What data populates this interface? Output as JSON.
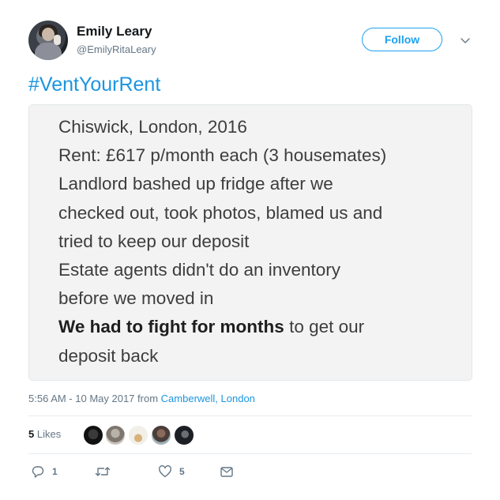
{
  "user": {
    "name": "Emily Leary",
    "handle": "@EmilyRitaLeary",
    "follow_label": "Follow"
  },
  "tweet": {
    "hashtag": "#VentYourRent",
    "image_text": {
      "lines": [
        "Chiswick, London, 2016",
        "Rent: £617 p/month each (3 housemates)",
        "Landlord bashed up fridge after we",
        "checked out, took photos, blamed us and",
        "tried to keep our deposit",
        "Estate agents didn't do an inventory",
        "before we moved in"
      ],
      "bold_part": "We had to fight for months",
      "after_bold": " to get our",
      "last_line": "deposit back"
    },
    "timestamp": "5:56 AM - 10 May 2017",
    "from_label": "from",
    "location": "Camberwell, London"
  },
  "stats": {
    "likes_count": "5",
    "likes_label": "Likes"
  },
  "actions": {
    "reply_count": "1",
    "retweet_count": "",
    "like_count": "5"
  },
  "colors": {
    "accent": "#1da1f2",
    "link": "#1b95e0",
    "muted": "#657786"
  },
  "icons": {
    "more": "chevron-down-icon",
    "reply": "reply-icon",
    "retweet": "retweet-icon",
    "like": "heart-icon",
    "dm": "envelope-icon"
  }
}
